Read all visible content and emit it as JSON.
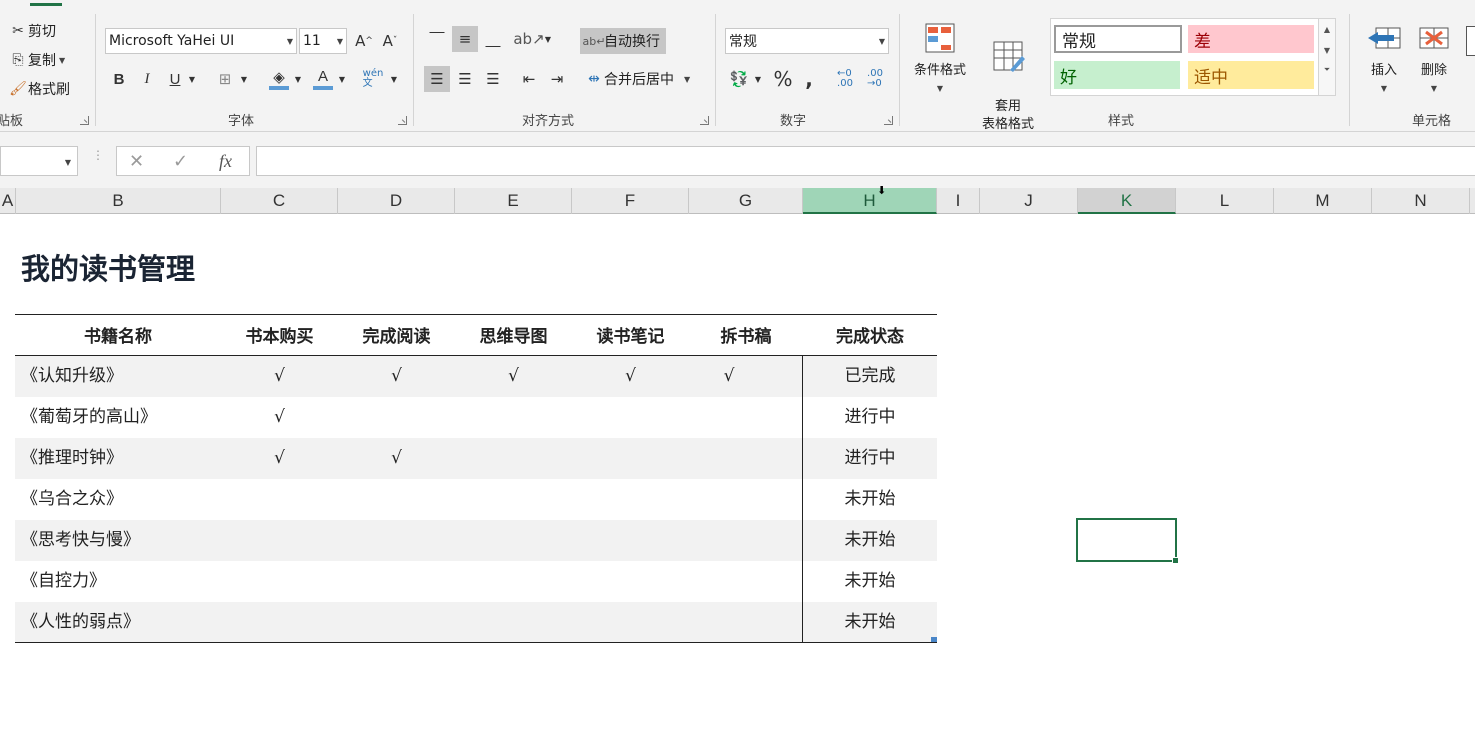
{
  "clipboard": {
    "cut": "剪切",
    "copy": "复制",
    "format_painter": "格式刷",
    "group_label": "剪贴板"
  },
  "font": {
    "font_name": "Microsoft YaHei UI",
    "font_size": "11",
    "bold": "B",
    "italic": "I",
    "underline": "U",
    "group_label": "字体"
  },
  "alignment": {
    "wrap_text": "自动换行",
    "merge_center": "合并后居中",
    "group_label": "对齐方式"
  },
  "number": {
    "format": "常规",
    "group_label": "数字"
  },
  "styles": {
    "conditional_format": "条件格式",
    "table_format": "套用\n表格格式",
    "cells": [
      {
        "label": "常规",
        "bg": "#ffffff",
        "fg": "#000000"
      },
      {
        "label": "差",
        "bg": "#ffc7ce",
        "fg": "#9c0006"
      },
      {
        "label": "好",
        "bg": "#c6efce",
        "fg": "#006100"
      },
      {
        "label": "适中",
        "bg": "#ffeb9c",
        "fg": "#9c5700"
      }
    ],
    "group_label": "样式"
  },
  "cells_group": {
    "insert": "插入",
    "delete": "删除",
    "group_label": "单元格"
  },
  "formula_bar": {
    "name_box": "",
    "formula": ""
  },
  "columns": [
    "A",
    "B",
    "C",
    "D",
    "E",
    "F",
    "G",
    "H",
    "I",
    "J",
    "K",
    "L",
    "M",
    "N"
  ],
  "sheet": {
    "title": "我的读书管理",
    "headers": [
      "书籍名称",
      "书本购买",
      "完成阅读",
      "思维导图",
      "读书笔记",
      "拆书稿",
      "完成状态"
    ],
    "rows": [
      [
        "《认知升级》",
        "√",
        "√",
        "√",
        "√",
        "√",
        "已完成"
      ],
      [
        "《葡萄牙的高山》",
        "√",
        "",
        "",
        "",
        "",
        "进行中"
      ],
      [
        "《推理时钟》",
        "√",
        "√",
        "",
        "",
        "",
        "进行中"
      ],
      [
        "《乌合之众》",
        "",
        "",
        "",
        "",
        "",
        "未开始"
      ],
      [
        "《思考快与慢》",
        "",
        "",
        "",
        "",
        "",
        "未开始"
      ],
      [
        "《自控力》",
        "",
        "",
        "",
        "",
        "",
        "未开始"
      ],
      [
        "《人性的弱点》",
        "",
        "",
        "",
        "",
        "",
        "未开始"
      ]
    ]
  },
  "colors": {
    "accent": "#217346",
    "selected_col_header": "#9fd5b7"
  }
}
